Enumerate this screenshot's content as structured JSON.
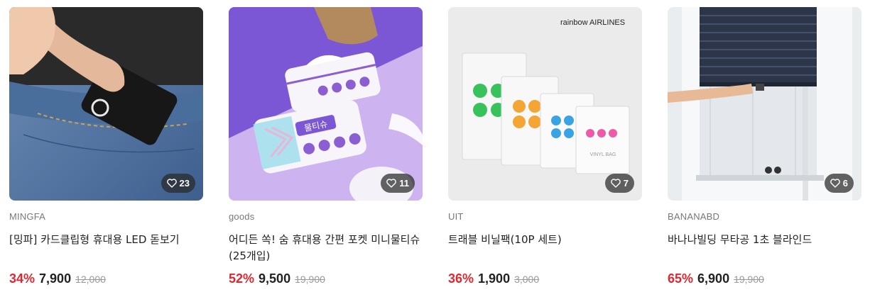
{
  "products": [
    {
      "brand": "MINGFA",
      "title": "[밍파] 카드클립형 휴대용 LED 돋보기",
      "likes": "23",
      "discount": "34%",
      "price": "7,900",
      "original_price": "12,000",
      "image_icon": "card-magnifier-photo"
    },
    {
      "brand": "goods",
      "title": "어디든 쏙! 숨 휴대용 간편 포켓 미니물티슈 (25개입)",
      "likes": "11",
      "discount": "52%",
      "price": "9,500",
      "original_price": "19,900",
      "image_icon": "wet-wipes-photo",
      "pack_label": "물티슈"
    },
    {
      "brand": "UIT",
      "title": "트래블 비닐팩(10P 세트)",
      "likes": "7",
      "discount": "36%",
      "price": "1,900",
      "original_price": "3,000",
      "image_icon": "vinyl-bags-photo",
      "airline_label": "rainbow AIRLINES",
      "bag_label": "VINYL BAG"
    },
    {
      "brand": "BANANABD",
      "title": "바나나빌딩 무타공 1초 블라인드",
      "likes": "6",
      "discount": "65%",
      "price": "6,900",
      "original_price": "19,900",
      "image_icon": "blind-window-photo"
    }
  ],
  "colors": {
    "discount": "#e0262f",
    "badge_bg": "#3a3a3a"
  }
}
